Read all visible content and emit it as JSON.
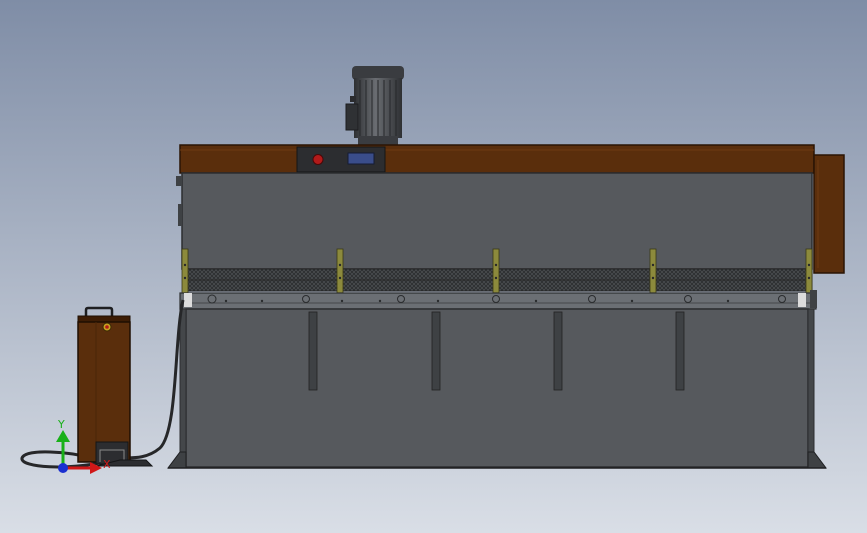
{
  "scene": {
    "background_top": "#7f8da6",
    "background_bottom": "#d9dee6"
  },
  "colors": {
    "frame_brown": "#5a2e0c",
    "frame_brown_dark": "#3d1d05",
    "machine_gray": "#56595d",
    "machine_gray_dark": "#3e4144",
    "machine_gray_light": "#6b6f74",
    "motor_gray": "#4a4c50",
    "bracket_olive": "#8c8a3c",
    "indicator_red": "#b21a1a",
    "display_blue": "#3a4d8a",
    "axis_x": "#d01818",
    "axis_y": "#18b018",
    "axis_z": "#1a2fd0"
  },
  "axis_triad": {
    "x_label": "X",
    "y_label": "Y"
  },
  "icons": {
    "motor": "motor-icon",
    "control_panel": "control-panel-icon",
    "foot_pedal": "foot-pedal-icon",
    "triad": "axis-triad-icon"
  }
}
